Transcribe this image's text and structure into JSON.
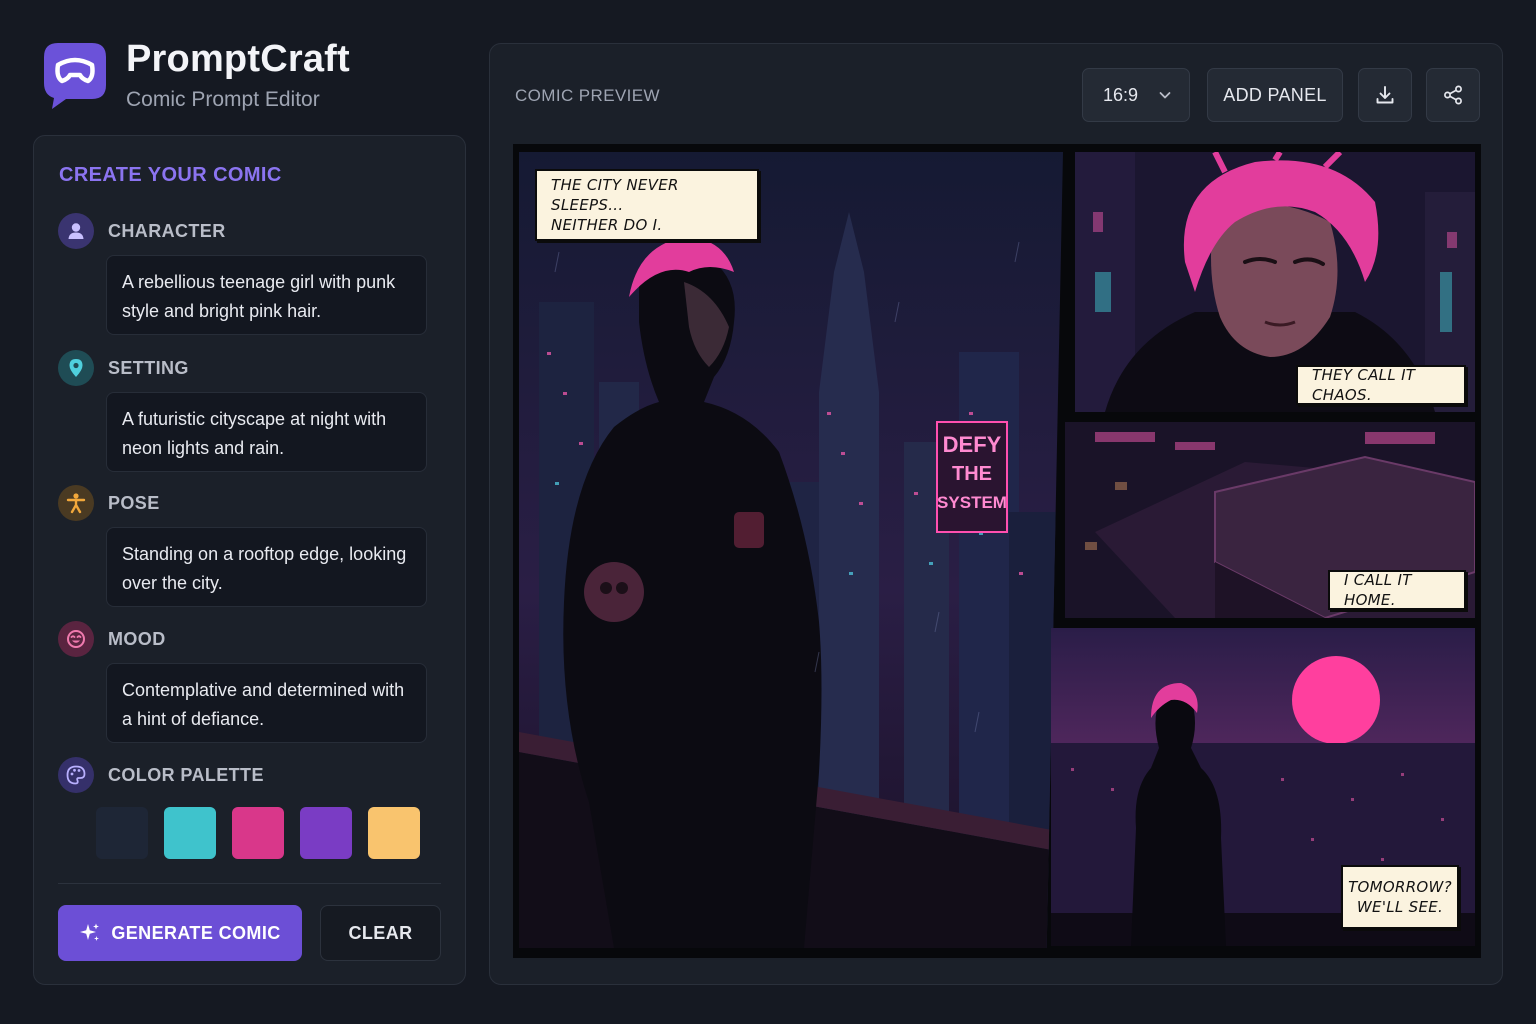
{
  "brand": {
    "title": "PromptCraft",
    "subtitle": "Comic Prompt Editor",
    "logo_icon": "chat-mask-icon",
    "accent": "#6c4fd6"
  },
  "editor": {
    "heading": "CREATE YOUR COMIC",
    "fields": [
      {
        "label": "CHARACTER",
        "icon": "user-icon",
        "icon_color": "#7b68d8",
        "value": "A rebellious teenage girl with punk style and bright pink hair."
      },
      {
        "label": "SETTING",
        "icon": "map-pin-icon",
        "icon_color": "#34b8c8",
        "value": "A futuristic cityscape at night with neon lights and rain."
      },
      {
        "label": "POSE",
        "icon": "figure-icon",
        "icon_color": "#f2a83b",
        "value": "Standing on a rooftop edge, looking over the city."
      },
      {
        "label": "MOOD",
        "icon": "mood-face-icon",
        "icon_color": "#e14b8f",
        "value": "Contemplative and determined with a hint of defiance."
      }
    ],
    "palette": {
      "label": "COLOR PALETTE",
      "icon": "palette-icon",
      "colors": [
        "#1e2636",
        "#3fc3cc",
        "#d9378a",
        "#7a3cc4",
        "#f9c46e"
      ]
    },
    "generate_label": "GENERATE COMIC",
    "clear_label": "CLEAR"
  },
  "preview": {
    "label": "COMIC PREVIEW",
    "aspect_ratio": "16:9",
    "add_panel_label": "ADD PANEL",
    "download_icon": "download-icon",
    "share_icon": "share-icon",
    "panels": [
      {
        "caption": "THE CITY NEVER SLEEPS...\nNEITHER DO I.",
        "sign": "DEFY\nTHE\nSYSTEM"
      },
      {
        "caption": "THEY CALL IT CHAOS."
      },
      {
        "caption": "I CALL IT HOME."
      },
      {
        "caption": "TOMORROW?\nWE'LL SEE."
      }
    ]
  }
}
